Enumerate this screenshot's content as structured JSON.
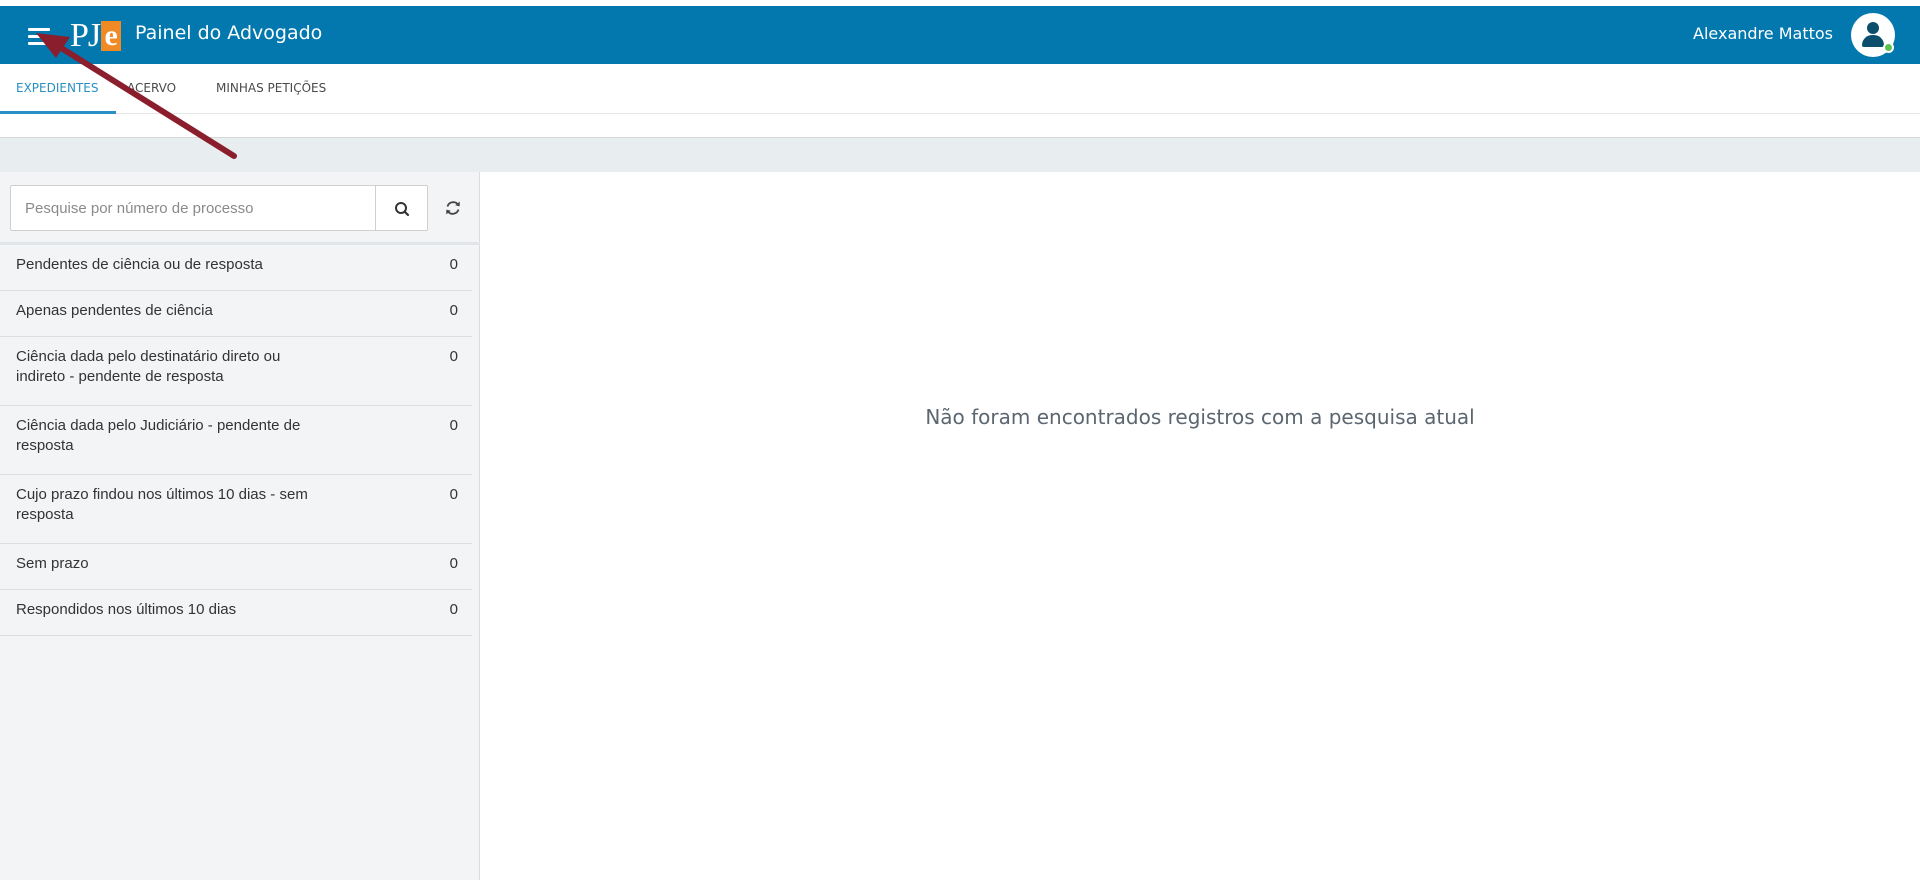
{
  "header": {
    "app_title": "Painel do Advogado",
    "logo_text": "PJ",
    "logo_e": "e",
    "user_name": "Alexandre Mattos"
  },
  "tabs": [
    {
      "label": "EXPEDIENTES",
      "active": true
    },
    {
      "label": "ACERVO",
      "active": false
    },
    {
      "label": "MINHAS PETIÇÕES",
      "active": false
    }
  ],
  "search": {
    "placeholder": "Pesquise por número de processo",
    "value": ""
  },
  "filters": [
    {
      "label": "Pendentes de ciência ou de resposta",
      "count": "0"
    },
    {
      "label": "Apenas pendentes de ciência",
      "count": "0"
    },
    {
      "label": "Ciência dada pelo destinatário direto ou indireto - pendente de resposta",
      "count": "0"
    },
    {
      "label": "Ciência dada pelo Judiciário - pendente de resposta",
      "count": "0"
    },
    {
      "label": "Cujo prazo findou nos últimos 10 dias - sem resposta",
      "count": "0"
    },
    {
      "label": "Sem prazo",
      "count": "0"
    },
    {
      "label": "Respondidos nos últimos 10 dias",
      "count": "0"
    }
  ],
  "main": {
    "empty_message": "Não foram encontrados registros com a pesquisa atual"
  },
  "colors": {
    "topbar": "#0278ae",
    "accent": "#2a8fc4",
    "logo_orange": "#f08a24",
    "annotation_arrow": "#8b1e2d",
    "online_status": "#5cc04e"
  },
  "icons": [
    "menu-icon",
    "search-icon",
    "refresh-icon",
    "user-avatar-icon"
  ]
}
